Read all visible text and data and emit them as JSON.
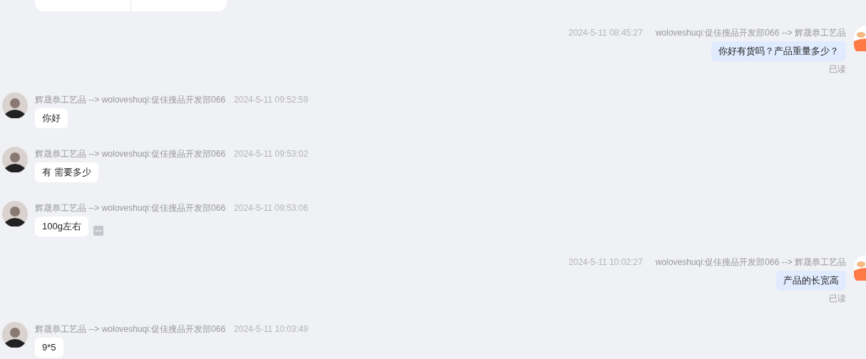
{
  "messages": [
    {
      "kind": "out",
      "time": "2024-5-11 08:45:27",
      "route": "woloveshuqi:促佳搜品开发部066 --> 辉晟恭工艺品",
      "text": "你好有货吗？产品重量多少？",
      "status": "已读",
      "more": false
    },
    {
      "kind": "in",
      "time": "2024-5-11 09:52:59",
      "route": "辉晟恭工艺品 --> woloveshuqi:促佳搜品开发部066",
      "text": "你好",
      "more": false
    },
    {
      "kind": "in",
      "time": "2024-5-11 09:53:02",
      "route": "辉晟恭工艺品 --> woloveshuqi:促佳搜品开发部066",
      "text": "有 需要多少",
      "more": false
    },
    {
      "kind": "in",
      "time": "2024-5-11 09:53:06",
      "route": "辉晟恭工艺品 --> woloveshuqi:促佳搜品开发部066",
      "text": "100g左右",
      "more": true
    },
    {
      "kind": "out",
      "time": "2024-5-11 10:02:27",
      "route": "woloveshuqi:促佳搜品开发部066 --> 辉晟恭工艺品",
      "text": "产品的长宽高",
      "status": "已读",
      "more": false
    },
    {
      "kind": "in",
      "time": "2024-5-11 10:03:49",
      "route": "辉晟恭工艺品 --> woloveshuqi:促佳搜品开发部066",
      "text": "9*5",
      "more": false
    }
  ]
}
